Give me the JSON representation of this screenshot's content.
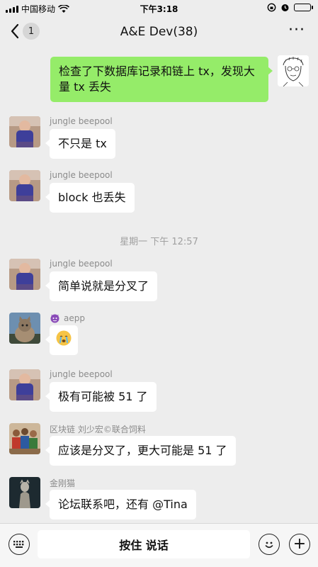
{
  "status_bar": {
    "carrier": "中国移动",
    "time": "下午3:18"
  },
  "nav": {
    "back_count": "1",
    "title": "A&E Dev(38)",
    "more_label": "···"
  },
  "messages": [
    {
      "sender": "",
      "text": "检查了下数据库记录和链上 tx，发现大量 tx 丢失",
      "self": true
    },
    {
      "sender": "jungle beepool",
      "text": "不只是 tx"
    },
    {
      "sender": "jungle beepool",
      "text": "block 也丢失"
    },
    {
      "sender": "jungle beepool",
      "text": "简单说就是分叉了"
    },
    {
      "sender": "aepp",
      "sender_icon": "devil-emoji-icon",
      "text": "",
      "content_icon": "crying-emoji-icon"
    },
    {
      "sender": "jungle beepool",
      "text": "极有可能被 51 了"
    },
    {
      "sender": "区块链 刘少宏©联合饲料",
      "text": "应该是分叉了，更大可能是 51 了"
    },
    {
      "sender": "金刚猫",
      "text": "论坛联系吧，还有 @Tina"
    }
  ],
  "timestamp": "星期一 下午 12:57",
  "input_bar": {
    "hold_to_talk": "按住 说话",
    "plus": "+"
  }
}
